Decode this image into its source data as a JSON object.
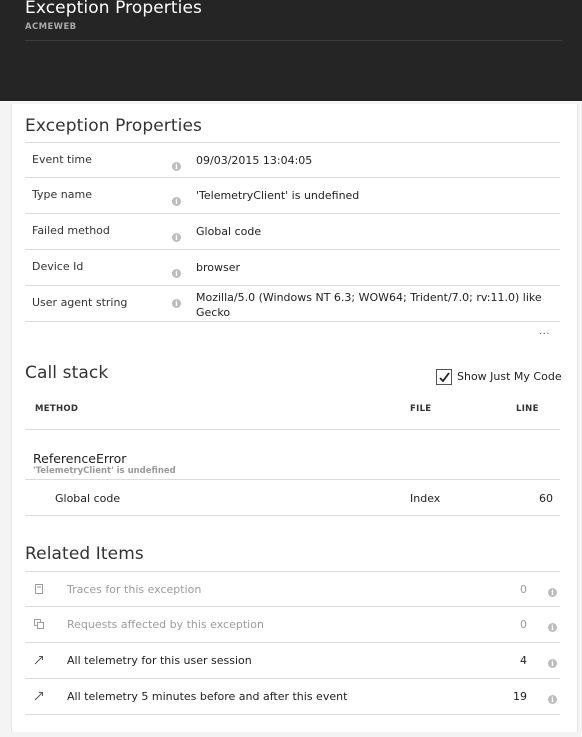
{
  "header": {
    "title": "Exception Properties",
    "subtitle": "ACMEWEB"
  },
  "properties": {
    "title": "Exception Properties",
    "rows": [
      {
        "label": "Event time",
        "value": "09/03/2015 13:04:05"
      },
      {
        "label": "Type name",
        "value": "'TelemetryClient' is undefined"
      },
      {
        "label": "Failed method",
        "value": "Global code"
      },
      {
        "label": "Device Id",
        "value": "browser"
      },
      {
        "label": "User agent string",
        "value": "Mozilla/5.0 (Windows NT 6.3; WOW64; Trident/7.0; rv:11.0) like Gecko"
      }
    ],
    "more": "..."
  },
  "call_stack": {
    "title": "Call stack",
    "show_just_my_code": {
      "label": "Show Just My Code",
      "checked": true
    },
    "columns": {
      "method": "METHOD",
      "file": "FILE",
      "line": "LINE"
    },
    "group": {
      "name": "ReferenceError",
      "message": "'TelemetryClient' is undefined"
    },
    "frames": [
      {
        "method": "Global code",
        "file": "Index",
        "line": "60"
      }
    ]
  },
  "related": {
    "title": "Related Items",
    "items": [
      {
        "label": "Traces for this exception",
        "count": "0",
        "icon": "document-icon",
        "enabled": false
      },
      {
        "label": "Requests affected by this exception",
        "count": "0",
        "icon": "requests-icon",
        "enabled": false
      },
      {
        "label": "All telemetry for this user session",
        "count": "4",
        "icon": "arrow-link-icon",
        "enabled": true
      },
      {
        "label": "All telemetry 5 minutes before and after this event",
        "count": "19",
        "icon": "arrow-link-icon",
        "enabled": true
      }
    ]
  },
  "colors": {
    "header_bg": "#252526",
    "body_bg": "#f4f4f4",
    "divider": "#dcdcdc",
    "disabled_text": "#9c9c9c"
  }
}
